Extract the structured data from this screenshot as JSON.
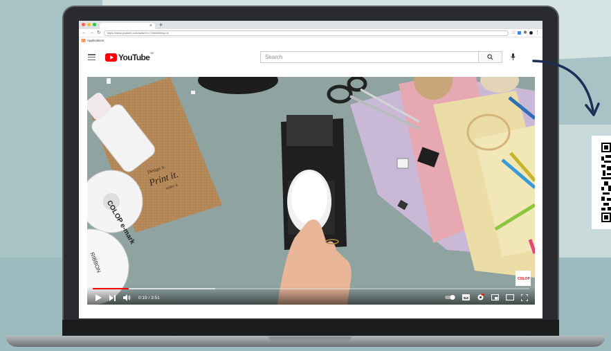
{
  "browser": {
    "tab_title": "",
    "url": "https://www.youtube.com/watch?v=Ywiw4Nmqv-w",
    "bookmark_label": "Applications",
    "new_tab_symbol": "+",
    "tab_close_symbol": "×"
  },
  "youtube": {
    "logo_text": "YouTube",
    "country_code": "BE",
    "search_placeholder": "Search"
  },
  "player": {
    "time_display": "0:19 / 3:51",
    "progress_fraction": 0.082,
    "buffer_fraction": 0.28,
    "progress_color": "#ff0000"
  },
  "video_frame": {
    "cork_text_line1": "Design it.",
    "cork_text_line2": "Print it.",
    "cork_text_line3": "make it.",
    "roll_text": "COLOP e-mark",
    "ribbon_text": "RIBBON",
    "corner_logo": "COLOP"
  },
  "colors": {
    "background": "#a7c3c6",
    "laptop": "#2a2b2e",
    "arrow": "#1d2d55",
    "youtube_red": "#ff0000"
  }
}
